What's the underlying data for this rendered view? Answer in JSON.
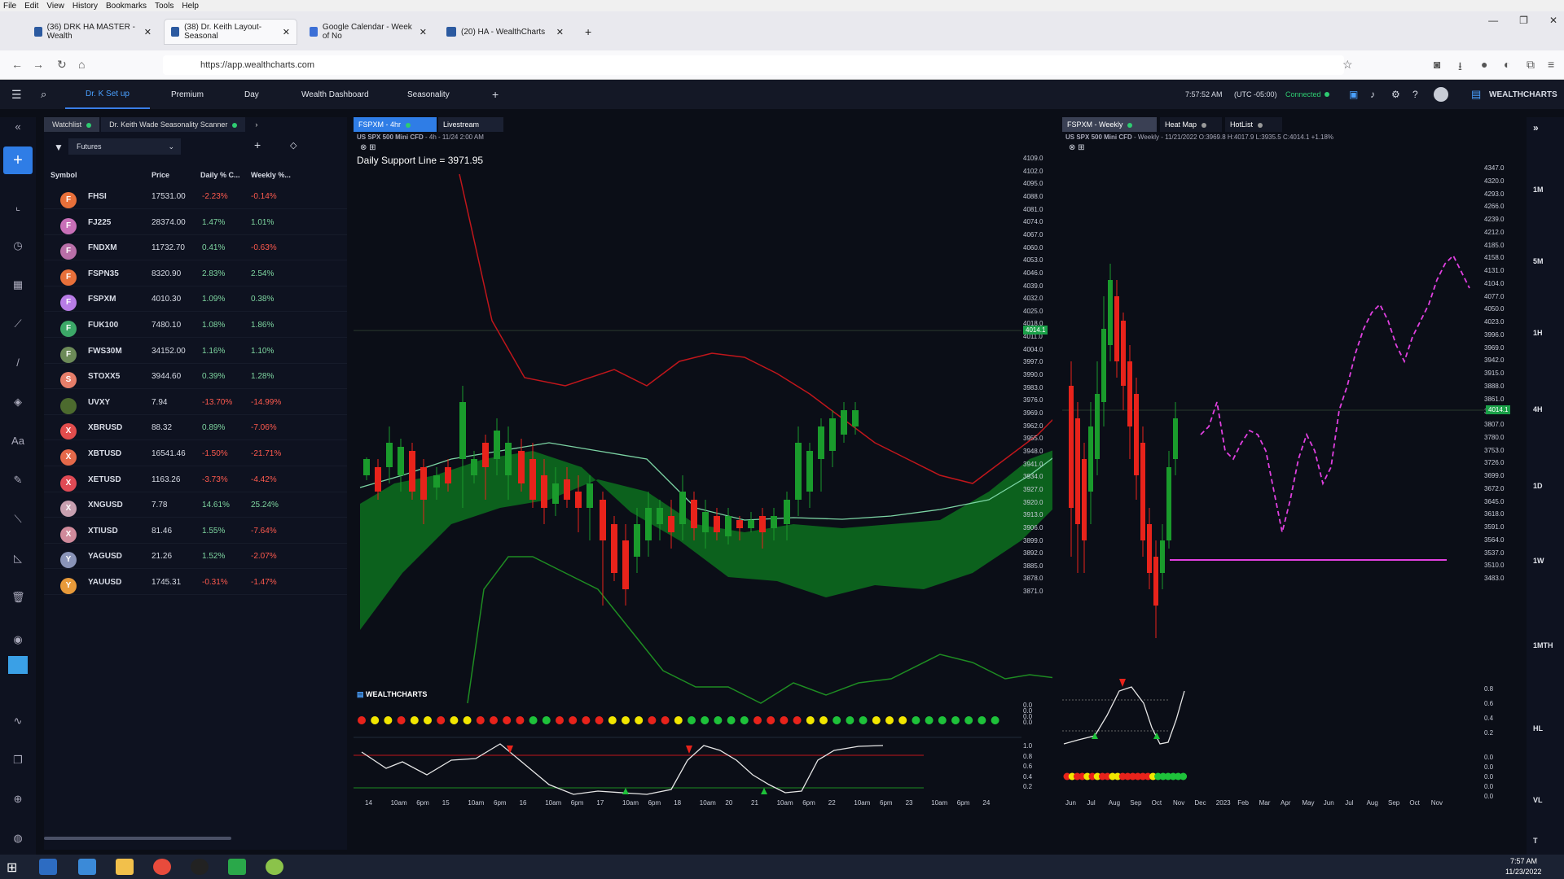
{
  "browser": {
    "menu": [
      "File",
      "Edit",
      "View",
      "History",
      "Bookmarks",
      "Tools",
      "Help"
    ],
    "tabs": [
      {
        "label": "(36) DRK HA MASTER - Wealth"
      },
      {
        "label": "(38) Dr. Keith Layout-Seasonal"
      },
      {
        "label": "Google Calendar - Week of No"
      },
      {
        "label": "(20) HA - WealthCharts"
      }
    ],
    "url": "https://app.wealthcharts.com"
  },
  "topnav": {
    "items": [
      "Dr. K Set up",
      "Premium",
      "Day",
      "Wealth Dashboard",
      "Seasonality"
    ],
    "time": "7:57:52 AM",
    "timezone": "(UTC -05:00)",
    "status": "Connected",
    "brand": "WEALTHCHARTS"
  },
  "watchlist": {
    "tab1": "Watchlist",
    "tab2": "Dr. Keith Wade Seasonality Scanner",
    "filter": "Futures",
    "headers": [
      "Symbol",
      "Price",
      "Daily % C...",
      "Weekly %..."
    ],
    "rows": [
      {
        "letter": "F",
        "color": "#e8703a",
        "symbol": "FHSI",
        "price": "17531.00",
        "daily": "-2.23%",
        "weekly": "-0.14%"
      },
      {
        "letter": "F",
        "color": "#c86fb7",
        "symbol": "FJ225",
        "price": "28374.00",
        "daily": "1.47%",
        "weekly": "1.01%"
      },
      {
        "letter": "F",
        "color": "#b96fa8",
        "symbol": "FNDXM",
        "price": "11732.70",
        "daily": "0.41%",
        "weekly": "-0.63%"
      },
      {
        "letter": "F",
        "color": "#e8703a",
        "symbol": "FSPN35",
        "price": "8320.90",
        "daily": "2.83%",
        "weekly": "2.54%"
      },
      {
        "letter": "F",
        "color": "#b87ce6",
        "symbol": "FSPXM",
        "price": "4010.30",
        "daily": "1.09%",
        "weekly": "0.38%"
      },
      {
        "letter": "F",
        "color": "#3ca868",
        "symbol": "FUK100",
        "price": "7480.10",
        "daily": "1.08%",
        "weekly": "1.86%"
      },
      {
        "letter": "F",
        "color": "#6c8a58",
        "symbol": "FWS30M",
        "price": "34152.00",
        "daily": "1.16%",
        "weekly": "1.10%"
      },
      {
        "letter": "S",
        "color": "#e77e6a",
        "symbol": "STOXX5",
        "price": "3944.60",
        "daily": "0.39%",
        "weekly": "1.28%"
      },
      {
        "letter": "",
        "color": "#4c6a2e",
        "symbol": "UVXY",
        "price": "7.94",
        "daily": "-13.70%",
        "weekly": "-14.99%"
      },
      {
        "letter": "X",
        "color": "#e24d4d",
        "symbol": "XBRUSD",
        "price": "88.32",
        "daily": "0.89%",
        "weekly": "-7.06%"
      },
      {
        "letter": "X",
        "color": "#e5694a",
        "symbol": "XBTUSD",
        "price": "16541.46",
        "daily": "-1.50%",
        "weekly": "-21.71%"
      },
      {
        "letter": "X",
        "color": "#e04a55",
        "symbol": "XETUSD",
        "price": "1163.26",
        "daily": "-3.73%",
        "weekly": "-4.42%"
      },
      {
        "letter": "X",
        "color": "#c8a0b0",
        "symbol": "XNGUSD",
        "price": "7.78",
        "daily": "14.61%",
        "weekly": "25.24%"
      },
      {
        "letter": "X",
        "color": "#d08a9b",
        "symbol": "XTIUSD",
        "price": "81.46",
        "daily": "1.55%",
        "weekly": "-7.64%"
      },
      {
        "letter": "Y",
        "color": "#8a94b8",
        "symbol": "YAGUSD",
        "price": "21.26",
        "daily": "1.52%",
        "weekly": "-2.07%"
      },
      {
        "letter": "Y",
        "color": "#e89a3a",
        "symbol": "YAUUSD",
        "price": "1745.31",
        "daily": "-0.31%",
        "weekly": "-1.47%"
      }
    ]
  },
  "chart1": {
    "tab": "FSPXM - 4hr",
    "tab2": "Livestream",
    "subtitle_symbol": "US SPX 500 Mini CFD",
    "subtitle_info": " - 4h - 11/24 2:00 AM",
    "annotation": "Daily Support Line = 3971.95",
    "watermark": "WEALTHCHARTS",
    "price_tag": "4014.1",
    "price_scale": [
      "4109.0",
      "4102.0",
      "4095.0",
      "4088.0",
      "4081.0",
      "4074.0",
      "4067.0",
      "4060.0",
      "4053.0",
      "4046.0",
      "4039.0",
      "4032.0",
      "4025.0",
      "4018.0",
      "4011.0",
      "4004.0",
      "3997.0",
      "3990.0",
      "3983.0",
      "3976.0",
      "3969.0",
      "3962.0",
      "3955.0",
      "3948.0",
      "3941.0",
      "3934.0",
      "3927.0",
      "3920.0",
      "3913.0",
      "3906.0",
      "3899.0",
      "3892.0",
      "3885.0",
      "3878.0",
      "3871.0"
    ],
    "ind1_scale": [
      "0.0",
      "0.0",
      "0.0",
      "0.0"
    ],
    "ind2_scale": [
      "1.0",
      "0.8",
      "0.6",
      "0.4",
      "0.2"
    ],
    "time_axis": [
      "14",
      "10am",
      "6pm",
      "15",
      "10am",
      "6pm",
      "16",
      "10am",
      "6pm",
      "17",
      "10am",
      "6pm",
      "18",
      "10am",
      "20",
      "21",
      "10am",
      "6pm",
      "22",
      "10am",
      "6pm",
      "23",
      "10am",
      "6pm",
      "24"
    ],
    "dots": [
      "r",
      "y",
      "y",
      "r",
      "y",
      "y",
      "r",
      "y",
      "y",
      "r",
      "r",
      "r",
      "r",
      "g",
      "g",
      "r",
      "r",
      "r",
      "r",
      "y",
      "y",
      "y",
      "r",
      "r",
      "y",
      "g",
      "g",
      "g",
      "g",
      "g",
      "r",
      "r",
      "r",
      "r",
      "y",
      "y",
      "g",
      "g",
      "g",
      "y",
      "y",
      "y",
      "g",
      "g",
      "g",
      "g",
      "g",
      "g",
      "g"
    ]
  },
  "chart2": {
    "tab": "FSPXM - Weekly",
    "tab2": "Heat Map",
    "tab3": "HotList",
    "subtitle_symbol": "US SPX 500 Mini CFD",
    "subtitle_info": " - Weekly - 11/21/2022 O:3969.8 H:4017.9 L:3935.5 C:4014.1 +1.18%",
    "price_tag": "4014.1",
    "price_scale": [
      "4347.0",
      "4320.0",
      "4293.0",
      "4266.0",
      "4239.0",
      "4212.0",
      "4185.0",
      "4158.0",
      "4131.0",
      "4104.0",
      "4077.0",
      "4050.0",
      "4023.0",
      "3996.0",
      "3969.0",
      "3942.0",
      "3915.0",
      "3888.0",
      "3861.0",
      "3834.0",
      "3807.0",
      "3780.0",
      "3753.0",
      "3726.0",
      "3699.0",
      "3672.0",
      "3645.0",
      "3618.0",
      "3591.0",
      "3564.0",
      "3537.0",
      "3510.0",
      "3483.0"
    ],
    "ind1_scale": [
      "0.8",
      "0.6",
      "0.4",
      "0.2"
    ],
    "ind2_scale": [
      "0.0",
      "0.0",
      "0.0",
      "0.0",
      "0.0"
    ],
    "time_axis": [
      "Jun",
      "Jul",
      "Aug",
      "Sep",
      "Oct",
      "Nov",
      "Dec",
      "2023",
      "Feb",
      "Mar",
      "Apr",
      "May",
      "Jun",
      "Jul",
      "Aug",
      "Sep",
      "Oct",
      "Nov"
    ],
    "dots": [
      "r",
      "y",
      "r",
      "r",
      "y",
      "r",
      "y",
      "r",
      "r",
      "y",
      "y",
      "r",
      "r",
      "r",
      "r",
      "r",
      "r",
      "y",
      "g",
      "g",
      "g",
      "g",
      "g",
      "g"
    ]
  },
  "timeframes": [
    "1M",
    "5M",
    "1H",
    "4H",
    "1D",
    "1W",
    "1MTH",
    "HL",
    "VL",
    "T"
  ],
  "taskbar": {
    "time": "7:57 AM",
    "date": "11/23/2022"
  }
}
